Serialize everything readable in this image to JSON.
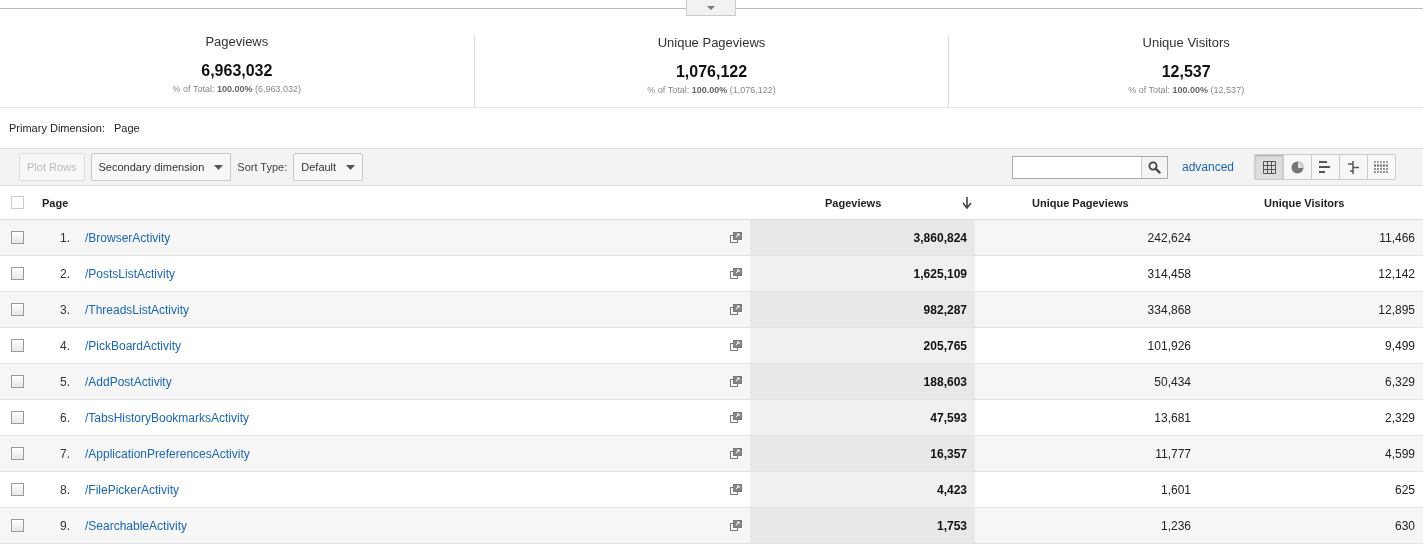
{
  "scorecards": [
    {
      "label": "Pageviews",
      "value": "6,963,032",
      "total_label": "% of Total:",
      "total_pct": "100.00%",
      "total_value": "(6,963,032)"
    },
    {
      "label": "Unique Pageviews",
      "value": "1,076,122",
      "total_label": "% of Total:",
      "total_pct": "100.00%",
      "total_value": "(1,076,122)"
    },
    {
      "label": "Unique Visitors",
      "value": "12,537",
      "total_label": "% of Total:",
      "total_pct": "100.00%",
      "total_value": "(12,537)"
    }
  ],
  "primary_dimension": {
    "label": "Primary Dimension:",
    "value": "Page"
  },
  "toolbar": {
    "plot_rows": {
      "label": "Plot Rows",
      "disabled": true
    },
    "secondary_dimension": "Secondary dimension",
    "sort_type_label": "Sort Type:",
    "sort_type": "Default",
    "advanced": "advanced",
    "views": [
      {
        "kind": "table",
        "selected": true
      },
      {
        "kind": "pie",
        "selected": false
      },
      {
        "kind": "bars",
        "selected": false
      },
      {
        "kind": "comparison",
        "selected": false
      },
      {
        "kind": "pivot",
        "selected": false
      }
    ]
  },
  "table": {
    "select_all": {
      "checked": false
    },
    "columns": [
      {
        "label": "Page",
        "sorted": false
      },
      {
        "label": "Pageviews",
        "sorted": true
      },
      {
        "label": "Unique Pageviews",
        "sorted": false
      },
      {
        "label": "Unique Visitors",
        "sorted": false
      }
    ],
    "rows": [
      {
        "checked": false,
        "index": "1.",
        "page": "/BrowserActivity",
        "pageviews": "3,860,824",
        "unique_pageviews": "242,624",
        "unique_visitors": "11,466"
      },
      {
        "checked": false,
        "index": "2.",
        "page": "/PostsListActivity",
        "pageviews": "1,625,109",
        "unique_pageviews": "314,458",
        "unique_visitors": "12,142"
      },
      {
        "checked": false,
        "index": "3.",
        "page": "/ThreadsListActivity",
        "pageviews": "982,287",
        "unique_pageviews": "334,868",
        "unique_visitors": "12,895"
      },
      {
        "checked": false,
        "index": "4.",
        "page": "/PickBoardActivity",
        "pageviews": "205,765",
        "unique_pageviews": "101,926",
        "unique_visitors": "9,499"
      },
      {
        "checked": false,
        "index": "5.",
        "page": "/AddPostActivity",
        "pageviews": "188,603",
        "unique_pageviews": "50,434",
        "unique_visitors": "6,329"
      },
      {
        "checked": false,
        "index": "6.",
        "page": "/TabsHistoryBookmarksActivity",
        "pageviews": "47,593",
        "unique_pageviews": "13,681",
        "unique_visitors": "2,329"
      },
      {
        "checked": false,
        "index": "7.",
        "page": "/ApplicationPreferencesActivity",
        "pageviews": "16,357",
        "unique_pageviews": "11,777",
        "unique_visitors": "4,599"
      },
      {
        "checked": false,
        "index": "8.",
        "page": "/FilePickerActivity",
        "pageviews": "4,423",
        "unique_pageviews": "1,601",
        "unique_visitors": "625"
      },
      {
        "checked": false,
        "index": "9.",
        "page": "/SearchableActivity",
        "pageviews": "1,753",
        "unique_pageviews": "1,236",
        "unique_visitors": "630"
      }
    ]
  }
}
